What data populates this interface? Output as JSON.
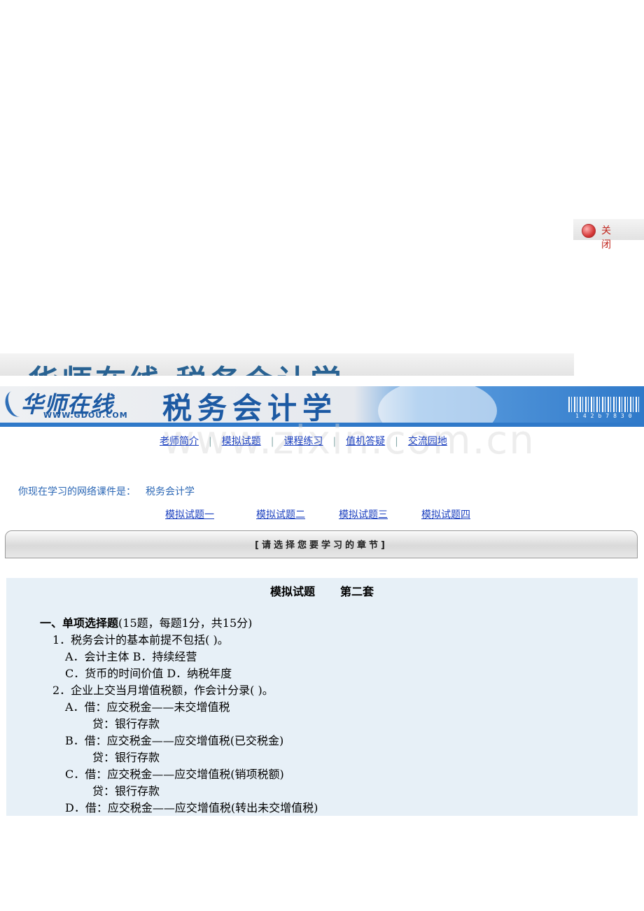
{
  "close_button": {
    "label": "关 闭"
  },
  "banner": {
    "logo_text": "华师在线",
    "logo_url": "WWW.GDOU.COM",
    "course_title": "税务会计学",
    "barcode_number": "142b7830"
  },
  "watermark": "www.zixin.com.cn",
  "nav": {
    "items": [
      "老师简介",
      "模拟试题",
      "课程练习",
      "值机答疑",
      "交流园地"
    ],
    "separator": "|"
  },
  "current_course": {
    "prefix": "你现在学习的网络课件是：",
    "name": "税务会计学"
  },
  "subnav": {
    "items": [
      "模拟试题一",
      "模拟试题二",
      "模拟试题三",
      "模拟试题四"
    ]
  },
  "chapter_bar": {
    "label": "[请选择您要学习的章节]"
  },
  "content": {
    "title_left": "模拟试题",
    "title_right": "第二套",
    "section_heading": "一、单项选择题",
    "section_note": "(15题，每题1分，共15分)",
    "lines": [
      "1．税务会计的基本前提不包括( )。",
      "A．会计主体 B．持续经营",
      "C．货币的时间价值 D．纳税年度",
      "2．企业上交当月增值税额，作会计分录( )。",
      "A．借：应交税金——未交增值税",
      "贷：银行存款",
      "B．借：应交税金——应交增值税(已交税金)",
      "贷：银行存款",
      "C．借：应交税金——应交增值税(销项税额)",
      "贷：银行存款",
      "D．借：应交税金——应交增值税(转出未交增值税)"
    ]
  },
  "colors": {
    "link": "#1a3fbf",
    "accent_blue": "#2f79c9",
    "course_text": "#2b67b5",
    "content_bg": "#e7f0f7",
    "close_red": "#c0241c"
  }
}
